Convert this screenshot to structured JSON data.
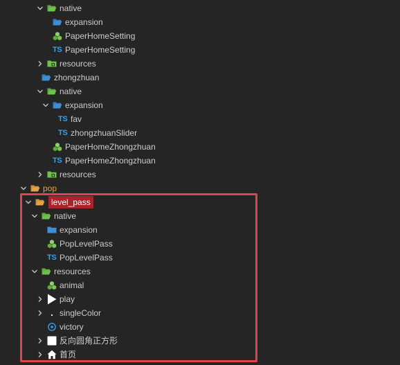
{
  "tree": {
    "n_native_1": "native",
    "n_expansion_1": "expansion",
    "n_paperhomesetting_prefab": "PaperHomeSetting",
    "n_paperhomesetting_ts": "PaperHomeSetting",
    "n_resources_1": "resources",
    "n_zhongzhuan": "zhongzhuan",
    "n_native_2": "native",
    "n_expansion_2": "expansion",
    "n_fav": "fav",
    "n_zhongzhuanslider": "zhongzhuanSlider",
    "n_paperhomezhongzhuan_prefab": "PaperHomeZhongzhuan",
    "n_paperhomezhongzhuan_ts": "PaperHomeZhongzhuan",
    "n_resources_2": "resources",
    "n_pop": "pop",
    "n_level_pass": "level_pass",
    "n_native_3": "native",
    "n_expansion_3": "expansion",
    "n_poplevelpass_prefab": "PopLevelPass",
    "n_poplevelpass_ts": "PopLevelPass",
    "n_resources_3": "resources",
    "n_animal": "animal",
    "n_play": "play",
    "n_singlecolor": "singleColor",
    "n_victory": "victory",
    "n_square": "反向圆角正方形",
    "n_home": "首页"
  },
  "ts_badge": "TS",
  "colors": {
    "background": "#252526",
    "text": "#cccccc",
    "folder_green": "#6cc24a",
    "folder_blue": "#3d8fd6",
    "folder_orange": "#e8a33d",
    "ts_blue": "#3b9ee8",
    "selection_border": "#e0444b",
    "selection_fill": "#a8232a"
  },
  "icons": {
    "chevron_open": "chevron-down-icon",
    "chevron_closed": "chevron-right-icon",
    "folder_open": "folder-open-icon",
    "folder": "folder-icon",
    "prefab": "prefab-icon",
    "ts": "typescript-icon",
    "resources": "resources-folder-icon",
    "play": "play-icon",
    "dot": "dot-icon",
    "particle": "particle-icon",
    "square": "square-icon",
    "home": "home-icon"
  }
}
